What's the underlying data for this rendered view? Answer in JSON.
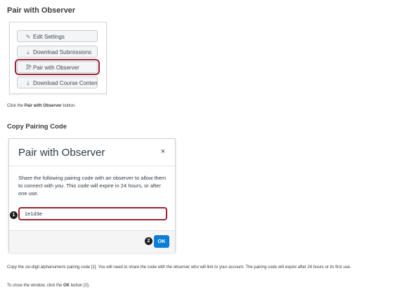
{
  "section1": {
    "heading": "Pair with Observer",
    "buttons": [
      {
        "label": "Edit Settings",
        "icon": "pencil-icon"
      },
      {
        "label": "Download Submissions",
        "icon": "download-icon"
      },
      {
        "label": "Pair with Observer",
        "icon": "users-icon"
      },
      {
        "label": "Download Course Content",
        "icon": "download-icon"
      }
    ],
    "caption_pre": "Click the ",
    "caption_bold": "Pair with Observer",
    "caption_post": " button."
  },
  "section2": {
    "heading": "Copy Pairing Code",
    "modal": {
      "title": "Pair with Observer",
      "close": "×",
      "description": "Share the following pairing code with an observer to allow them to connect with you. This code will expire in 24 hours, or after one use.",
      "code": "1e1d3e",
      "ok_label": "OK",
      "badge1": "1",
      "badge2": "2"
    },
    "para1": "Copy the six-digit alphanumeric pairing code [1]. You will need to share the code with the observer who will link to your account. The pairing code will expire after 24 hours or its first use.",
    "para2_pre": "To close the window, click the ",
    "para2_bold": "OK",
    "para2_post": " button [2]."
  },
  "colors": {
    "highlight": "#9d2235",
    "primary": "#0b7ed7"
  }
}
